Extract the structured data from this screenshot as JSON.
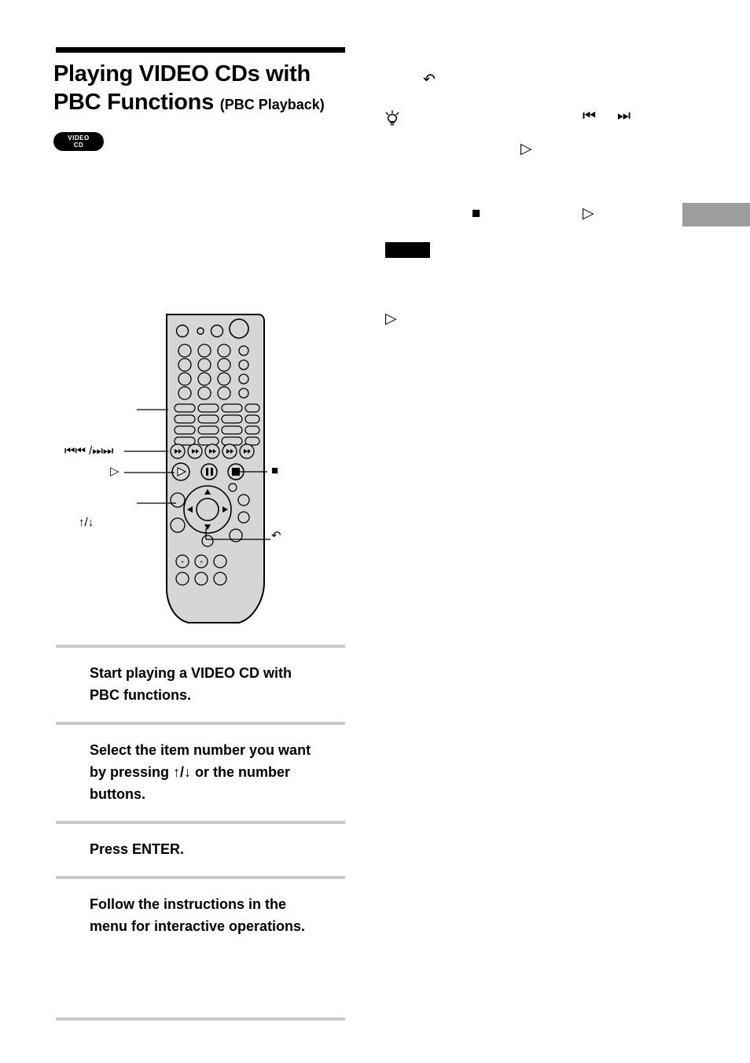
{
  "page": {
    "title_main_line1": "Playing VIDEO CDs with",
    "title_main_line2": "PBC Functions",
    "title_sub": "(PBC Playback)",
    "disc_badge_line1": "VIDEO",
    "disc_badge_line2": "CD"
  },
  "remote": {
    "callouts": [
      {
        "name": "number-buttons",
        "label": ""
      },
      {
        "name": "prev-next-buttons",
        "label": "⏮⏮ /⏭⏭"
      },
      {
        "name": "play-button",
        "label": "▷"
      },
      {
        "name": "enter-button",
        "label": ""
      },
      {
        "name": "updown-buttons",
        "label": "↑/↓"
      },
      {
        "name": "stop-button",
        "label": "■"
      },
      {
        "name": "return-button",
        "label": "↶"
      }
    ]
  },
  "right_column": {
    "return_glyph": "↶",
    "prev_glyph": "⏮",
    "next_glyph": "⏭",
    "play_glyph_1": "▷",
    "stop_glyph": "■",
    "play_glyph_2": "▷",
    "play_glyph_3": "▷"
  },
  "steps": [
    {
      "name": "step-start-playing",
      "text": "Start playing a VIDEO CD with PBC functions."
    },
    {
      "name": "step-select-item",
      "text": "Select the item number you want by pressing ↑/↓ or the number buttons."
    },
    {
      "name": "step-press-enter",
      "text": "Press ENTER."
    },
    {
      "name": "step-follow-instructions",
      "text": "Follow the instructions in the menu for interactive operations."
    }
  ],
  "colors": {
    "rule_gray": "#c9c9c9",
    "tab_gray": "#9d9d9d",
    "remote_body": "#d6d6d6",
    "black": "#000000"
  }
}
